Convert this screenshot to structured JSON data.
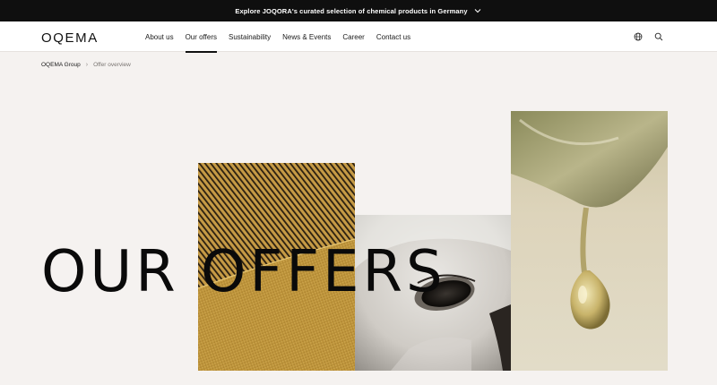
{
  "announcement": {
    "text": "Explore JOQORA's curated selection of chemical products in Germany"
  },
  "header": {
    "logo": "OQEMA",
    "menu": [
      {
        "label": "About us"
      },
      {
        "label": "Our offers",
        "active": true
      },
      {
        "label": "Sustainability"
      },
      {
        "label": "News & Events"
      },
      {
        "label": "Career"
      },
      {
        "label": "Contact us"
      }
    ],
    "icons": [
      "globe-icon",
      "search-icon"
    ]
  },
  "breadcrumb": {
    "items": [
      "OQEMA Group",
      "Offer overview"
    ]
  },
  "hero": {
    "title": "OUR OFFERS"
  },
  "colors": {
    "topbar": "#0f0f0f",
    "page_bg": "#f5f2f0",
    "gold": "#b8923a",
    "drop_bg": "#d8cfb3"
  }
}
